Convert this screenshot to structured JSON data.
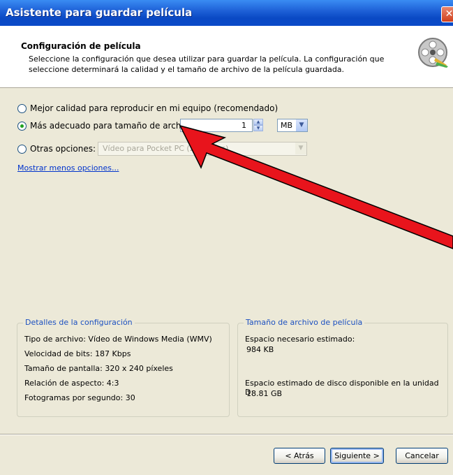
{
  "window": {
    "title": "Asistente para guardar película",
    "close_glyph": "✕"
  },
  "header": {
    "title": "Configuración de película",
    "description": "Seleccione la configuración que desea utilizar para guardar la película. La configuración que seleccione determinará la calidad y el tamaño de archivo de la película guardada.",
    "icon": "film-reel-icon"
  },
  "options": {
    "best_quality": {
      "label": "Mejor calidad para reproducir en mi equipo (recomendado)",
      "selected": false
    },
    "file_size": {
      "label": "Más adecuado para tamaño de archivo:",
      "selected": true,
      "value": "1",
      "unit": "MB"
    },
    "other": {
      "label": "Otras opciones:",
      "selected": false,
      "value": "Vídeo para Pocket PC (218 Kbps)"
    },
    "show_less_link": "Mostrar menos opciones..."
  },
  "details": {
    "title": "Detalles de la configuración",
    "lines": [
      "Tipo de archivo: Vídeo de Windows Media (WMV)",
      "Velocidad de bits: 187 Kbps",
      "Tamaño de pantalla: 320 x 240 píxeles",
      "Relación de aspecto: 4:3",
      "Fotogramas por segundo: 30"
    ]
  },
  "filesize": {
    "title": "Tamaño de archivo de película",
    "estimated_label": "Espacio necesario estimado:",
    "estimated_value": "984 KB",
    "disk_label": "Espacio estimado de disco disponible en la unidad D:",
    "disk_value": "18.81 GB"
  },
  "buttons": {
    "back": "< Atrás",
    "next": "Siguiente >",
    "cancel": "Cancelar"
  },
  "colors": {
    "titlebar": "#0a49c4",
    "accent_link": "#0033cc",
    "group_title": "#1c50c0",
    "annotation_arrow": "#e8141c"
  }
}
